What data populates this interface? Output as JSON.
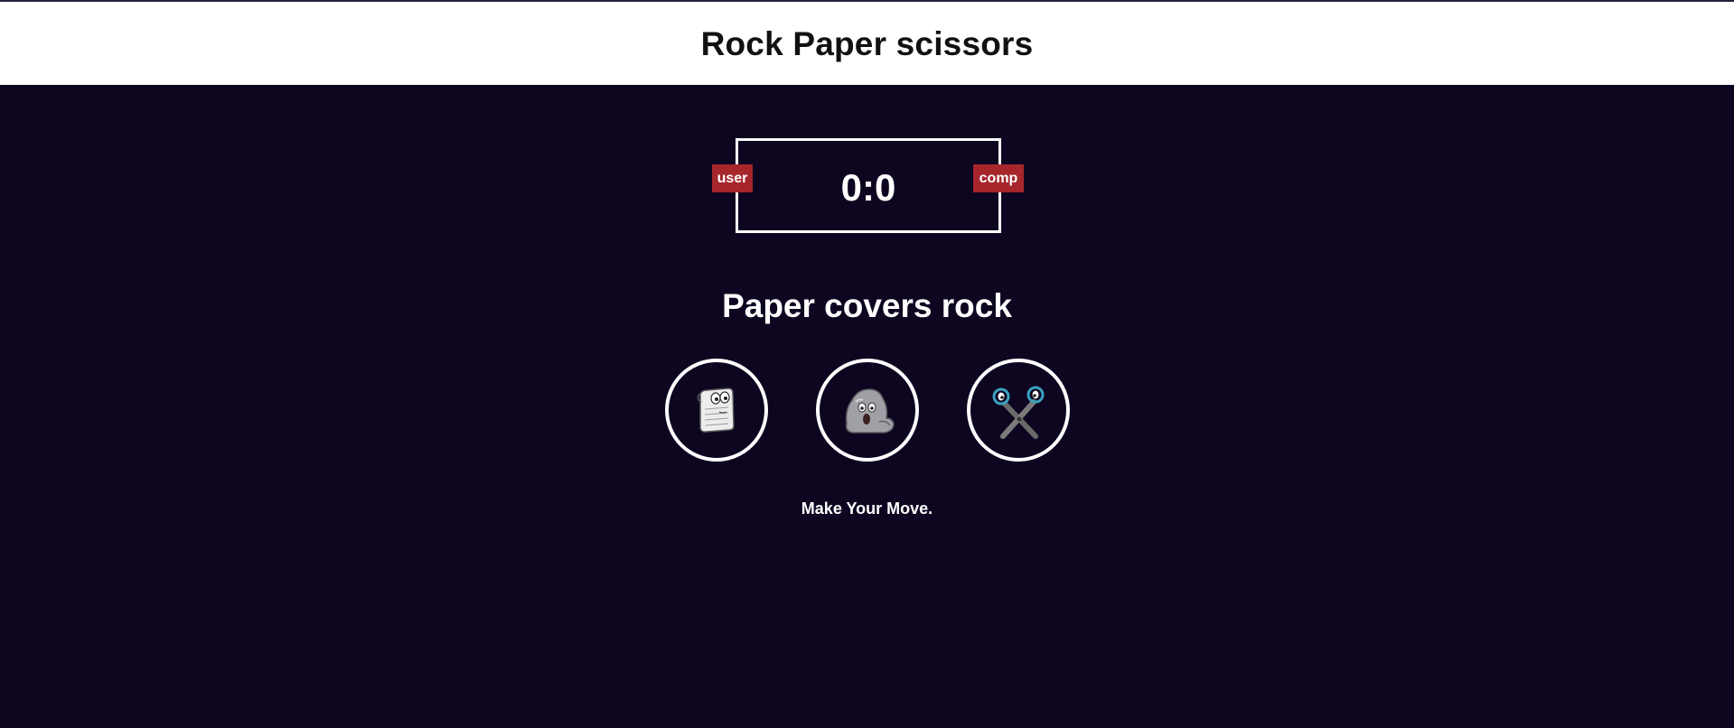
{
  "header": {
    "title": "Rock Paper scissors"
  },
  "scoreboard": {
    "score": "0:0",
    "user_label": "user",
    "comp_label": "comp"
  },
  "result": {
    "text": "Paper covers rock"
  },
  "choices": [
    {
      "id": "paper",
      "icon": "paper-icon"
    },
    {
      "id": "rock",
      "icon": "rock-icon"
    },
    {
      "id": "scissors",
      "icon": "scissors-icon"
    }
  ],
  "message": {
    "text": "Make Your Move."
  },
  "colors": {
    "background": "#0e0520",
    "header_bg": "#ffffff",
    "badge": "#a6262c",
    "border": "#ffffff"
  }
}
